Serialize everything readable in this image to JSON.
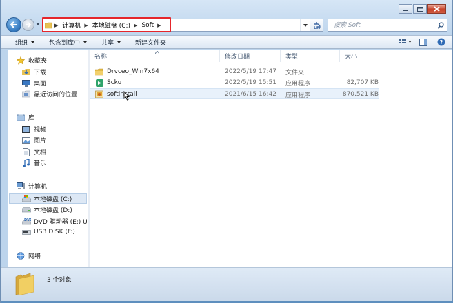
{
  "window": {
    "caption_buttons": [
      "minimize",
      "maximize",
      "close"
    ]
  },
  "address_bar": {
    "breadcrumbs": [
      "计算机",
      "本地磁盘 (C:)",
      "Soft"
    ],
    "highlight_color": "#e5262c"
  },
  "search": {
    "placeholder": "搜索 Soft"
  },
  "toolbar": {
    "organize": "组织",
    "include_in_library": "包含到库中",
    "share": "共享",
    "new_folder": "新建文件夹"
  },
  "nav_pane": {
    "favorites": {
      "label": "收藏夹",
      "items": [
        {
          "label": "下载",
          "icon": "download-folder-icon"
        },
        {
          "label": "桌面",
          "icon": "desktop-icon"
        },
        {
          "label": "最近访问的位置",
          "icon": "recent-places-icon"
        }
      ]
    },
    "libraries": {
      "label": "库",
      "items": [
        {
          "label": "视频",
          "icon": "video-library-icon"
        },
        {
          "label": "图片",
          "icon": "pictures-library-icon"
        },
        {
          "label": "文档",
          "icon": "documents-library-icon"
        },
        {
          "label": "音乐",
          "icon": "music-library-icon"
        }
      ]
    },
    "computer": {
      "label": "计算机",
      "items": [
        {
          "label": "本地磁盘 (C:)",
          "icon": "system-drive-icon",
          "selected": true
        },
        {
          "label": "本地磁盘 (D:)",
          "icon": "drive-icon"
        },
        {
          "label": "DVD 驱动器 (E:) Us",
          "icon": "dvd-drive-icon"
        },
        {
          "label": "USB DISK (F:)",
          "icon": "usb-drive-icon"
        }
      ]
    },
    "network": {
      "label": "网络"
    }
  },
  "file_list": {
    "columns": [
      "名称",
      "修改日期",
      "类型",
      "大小"
    ],
    "rows": [
      {
        "name": "Drvceo_Win7x64",
        "modified": "2022/5/19 17:47",
        "type": "文件夹",
        "size": "",
        "icon": "folder-icon"
      },
      {
        "name": "Scku",
        "modified": "2022/5/19 15:51",
        "type": "应用程序",
        "size": "82,707 KB",
        "icon": "scku-app-icon"
      },
      {
        "name": "softinstall",
        "modified": "2021/6/15 16:42",
        "type": "应用程序",
        "size": "870,521 KB",
        "icon": "installer-app-icon"
      }
    ]
  },
  "status_bar": {
    "item_count": "3 个对象"
  }
}
